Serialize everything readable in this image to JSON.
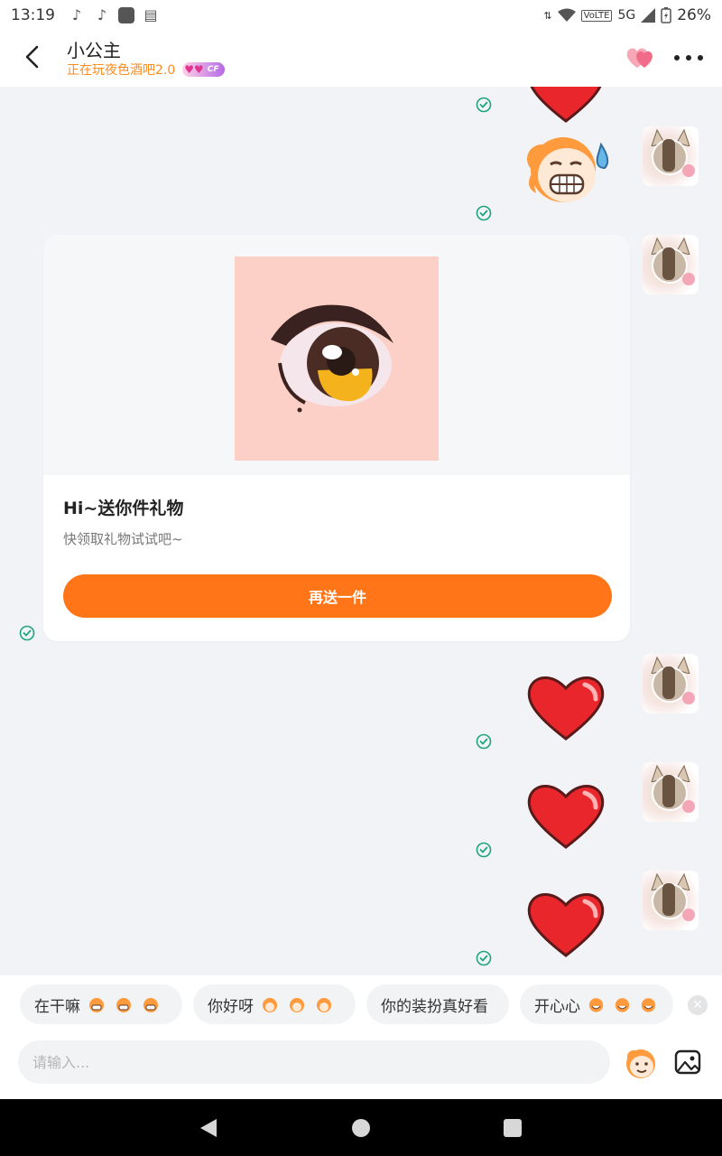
{
  "status_bar": {
    "time": "13:19",
    "network": "5G",
    "volte": "VoLTE",
    "battery": "26%"
  },
  "header": {
    "title": "小公主",
    "subtitle": "正在玩夜色酒吧2.0",
    "badge_text": "CF"
  },
  "gift_card": {
    "title": "Hi~送你件礼物",
    "subtitle": "快领取礼物试试吧~",
    "button_label": "再送一件"
  },
  "quick_replies": [
    {
      "text": "在干嘛"
    },
    {
      "text": "你好呀"
    },
    {
      "text": "你的装扮真好看"
    },
    {
      "text": "开心心"
    }
  ],
  "input": {
    "placeholder": "请输入..."
  },
  "colors": {
    "accent": "#ff7518",
    "subtitle": "#ff8a1c",
    "check": "#1ca67a",
    "heart": "#e8262b"
  }
}
